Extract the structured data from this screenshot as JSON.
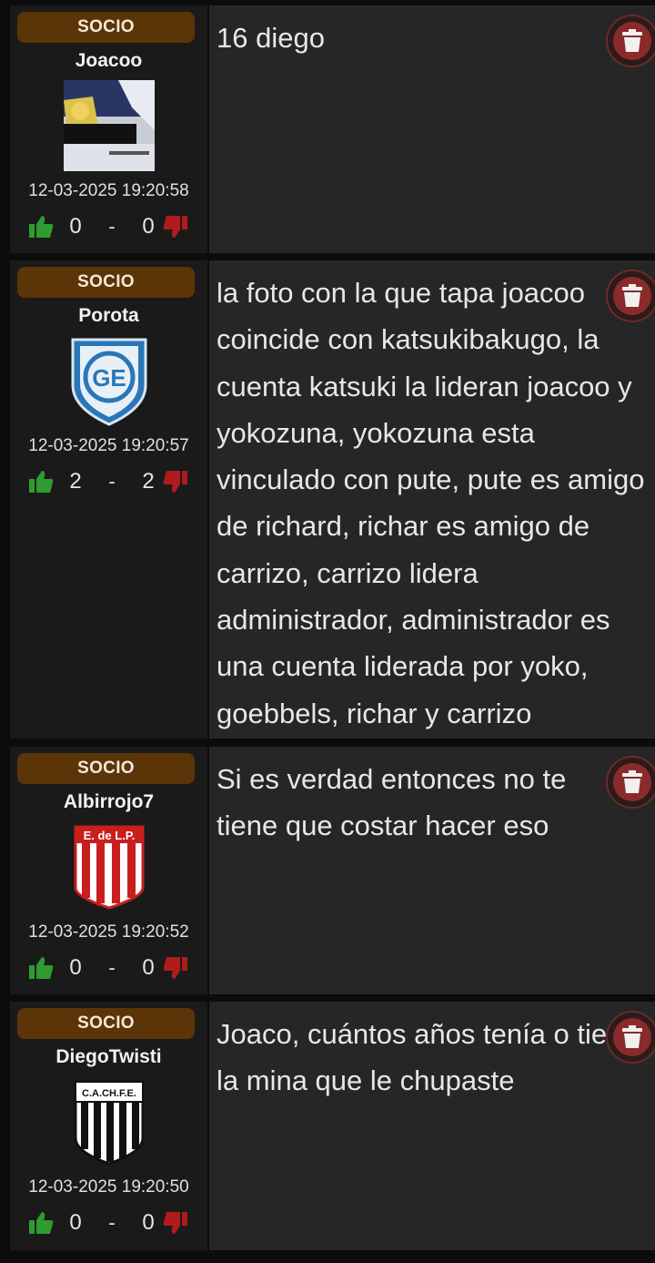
{
  "posts": [
    {
      "badge": "SOCIO",
      "username": "Joacoo",
      "avatar": "photo-thumbnail",
      "timestamp": "12-03-2025 19:20:58",
      "likes": "0",
      "dislikes": "0",
      "text": "16 diego"
    },
    {
      "badge": "SOCIO",
      "username": "Porota",
      "avatar": "club-shield-blue-ge",
      "timestamp": "12-03-2025 19:20:57",
      "likes": "2",
      "dislikes": "2",
      "text": "la foto con la que tapa joacoo coincide con katsukibakugo, la cuenta katsuki la lideran joacoo y yokozuna, yokozuna esta vinculado con pute, pute es amigo de richard, richar es amigo de carrizo, carrizo lidera administrador, administrador es una cuenta liderada por yoko, goebbels, richar y carrizo"
    },
    {
      "badge": "SOCIO",
      "username": "Albirrojo7",
      "avatar": "club-shield-red-white-edelp",
      "avatar_label": "E. de L.P.",
      "timestamp": "12-03-2025 19:20:52",
      "likes": "0",
      "dislikes": "0",
      "text": "Si es verdad entonces no te tiene que costar hacer eso"
    },
    {
      "badge": "SOCIO",
      "username": "DiegoTwisti",
      "avatar": "club-shield-black-white-cachfe",
      "avatar_label": "C.A.CH.F.E.",
      "timestamp": "12-03-2025 19:20:50",
      "likes": "0",
      "dislikes": "0",
      "text": "Joaco, cuántos años tenía o tiene la mina que le chupaste"
    }
  ],
  "colors": {
    "badge_bg": "#5b3408",
    "like": "#2e9c2e",
    "dislike": "#b01c1c",
    "delete": "#8b2a2a"
  }
}
